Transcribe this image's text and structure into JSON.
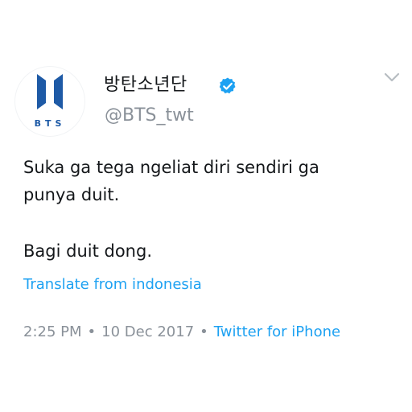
{
  "avatar": {
    "logo_text": "BTS",
    "logo_color": "#1e5aa6",
    "icon": "bts-logo-icon"
  },
  "user": {
    "display_name": "방탄소년단",
    "handle": "@BTS_twt",
    "verified_icon": "verified-badge-icon",
    "verified_color": "#1da1f2"
  },
  "menu": {
    "icon": "chevron-down-icon"
  },
  "tweet": {
    "lines": [
      "Suka ga tega ngeliat diri sendiri ga",
      "punya duit.",
      "Bagi duit dong."
    ],
    "translate_label": "Translate from indonesia",
    "time": "2:25 PM",
    "separator": "•",
    "date": "10 Dec 2017",
    "source": "Twitter for iPhone"
  },
  "colors": {
    "text": "#14171a",
    "secondary": "#8a9199",
    "link": "#1da1f2"
  }
}
